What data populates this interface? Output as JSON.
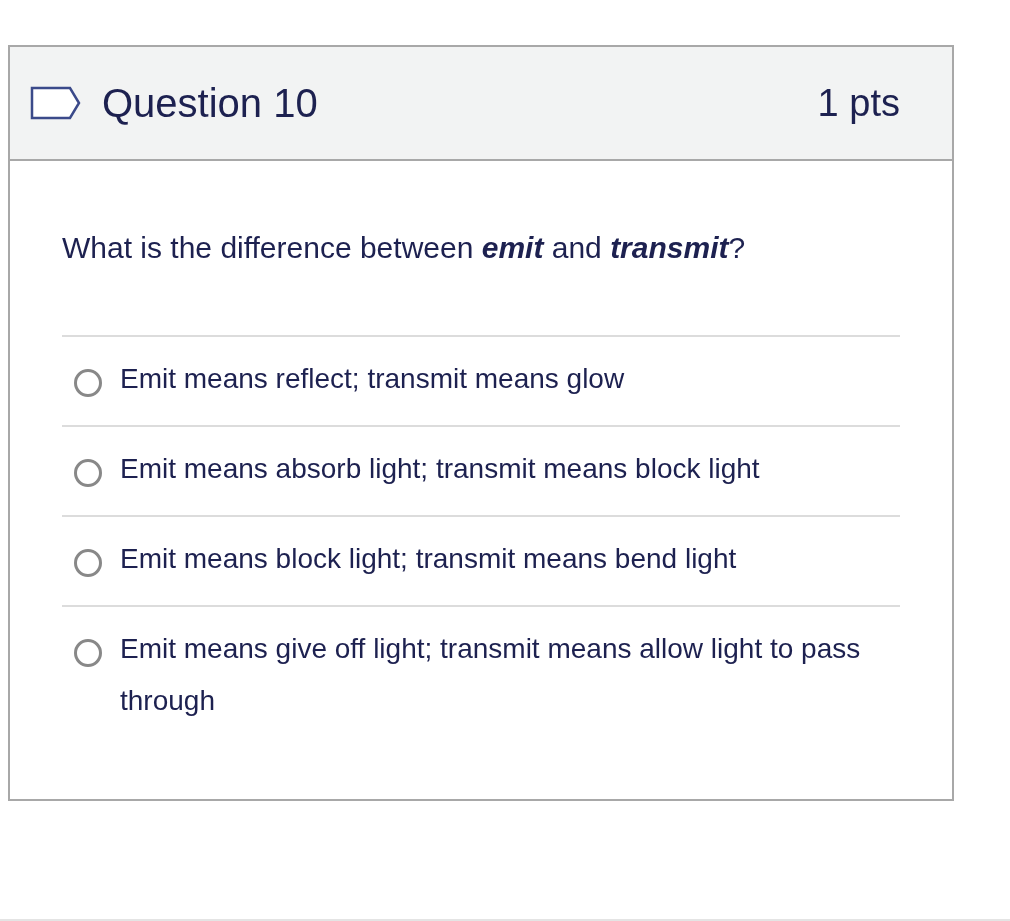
{
  "question": {
    "title": "Question 10",
    "points": "1 pts",
    "flagged": false,
    "text": "What is the difference between **emit** and **transmit**?",
    "answers": [
      {
        "label": "Emit means reflect; transmit means glow",
        "selected": false
      },
      {
        "label": "Emit means absorb light; transmit means block light",
        "selected": false
      },
      {
        "label": "Emit means block light; transmit means bend light",
        "selected": false
      },
      {
        "label": "Emit means give off light; transmit means allow light to pass through",
        "selected": false
      }
    ]
  }
}
